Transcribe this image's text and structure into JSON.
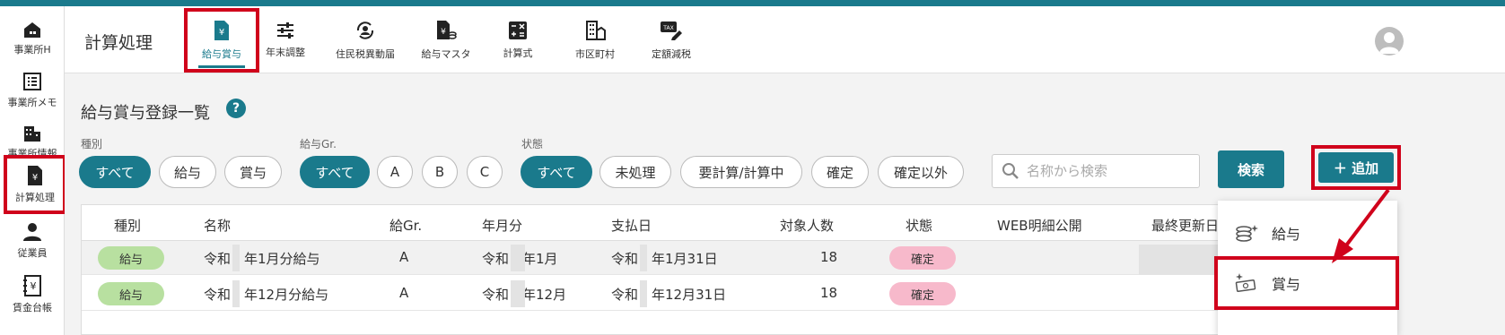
{
  "sidebar": {
    "items": [
      {
        "label": "事業所H",
        "icon": "home-building-icon"
      },
      {
        "label": "事業所メモ",
        "icon": "list-icon"
      },
      {
        "label": "事業所情報",
        "icon": "office-building-icon"
      },
      {
        "label": "計算処理",
        "icon": "yen-document-icon",
        "active": true
      },
      {
        "label": "従業員",
        "icon": "person-icon"
      },
      {
        "label": "賃金台帳",
        "icon": "yen-ledger-icon"
      }
    ]
  },
  "header": {
    "title": "計算処理",
    "tabs": [
      {
        "label": "給与賞与",
        "icon": "yen-document-icon",
        "active": true
      },
      {
        "label": "年末調整",
        "icon": "sliders-icon"
      },
      {
        "label": "住民税異動届",
        "icon": "refresh-person-icon"
      },
      {
        "label": "給与マスタ",
        "icon": "yen-document-coins-icon"
      },
      {
        "label": "計算式",
        "icon": "calculator-icon"
      },
      {
        "label": "市区町村",
        "icon": "city-icon"
      },
      {
        "label": "定額減税",
        "icon": "tax-pencil-icon"
      }
    ]
  },
  "page": {
    "title": "給与賞与登録一覧",
    "help": "?"
  },
  "filters": {
    "type": {
      "label": "種別",
      "options": [
        "すべて",
        "給与",
        "賞与"
      ],
      "selected": "すべて"
    },
    "group": {
      "label": "給与Gr.",
      "options": [
        "すべて",
        "A",
        "B",
        "C"
      ],
      "selected": "すべて"
    },
    "status": {
      "label": "状態",
      "options": [
        "すべて",
        "未処理",
        "要計算/計算中",
        "確定",
        "確定以外"
      ],
      "selected": "すべて"
    }
  },
  "search": {
    "placeholder": "名称から検索",
    "value": ""
  },
  "buttons": {
    "search": "検索",
    "add": "＋ 追加"
  },
  "table": {
    "columns": [
      "種別",
      "名称",
      "給Gr.",
      "年月分",
      "支払日",
      "対象人数",
      "状態",
      "WEB明細公開",
      "最終更新日"
    ],
    "rows": [
      {
        "type": "給与",
        "name": "令和　年1月分給与",
        "group": "A",
        "month": "令和　年1月",
        "paydate": "令和　年1月31日",
        "count": "18",
        "status": "確定"
      },
      {
        "type": "給与",
        "name": "令和　年12月分給与",
        "group": "A",
        "month": "令和　年12月",
        "paydate": "令和　年12月31日",
        "count": "18",
        "status": "確定"
      }
    ]
  },
  "dropdown": {
    "items": [
      {
        "label": "給与",
        "icon": "coins-sparkle-icon"
      },
      {
        "label": "賞与",
        "icon": "money-sparkle-icon"
      }
    ]
  },
  "colors": {
    "accent": "#1a7a8c",
    "highlight": "#d0021b",
    "green_pill": "#b8e0a0",
    "pink_pill": "#f7b9cb"
  }
}
